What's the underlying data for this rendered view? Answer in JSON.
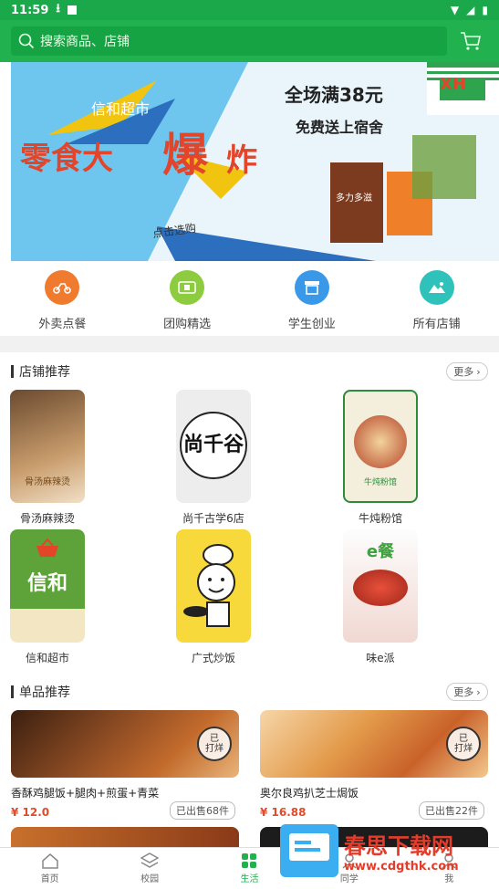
{
  "status": {
    "time": "11:59"
  },
  "header": {
    "search_placeholder": "搜索商品、店铺"
  },
  "banner": {
    "brand": "信和超市",
    "headline": "零食大",
    "headline2": "爆",
    "headline3": "炸",
    "promo_line1": "全场满38元",
    "promo_line2": "免费送上宿舍",
    "button": "点击选购",
    "logo_text": "XH",
    "chips_text": "多力多滋"
  },
  "quick": [
    {
      "label": "外卖点餐",
      "color": "#f07a2e"
    },
    {
      "label": "团购精选",
      "color": "#8ccc3e"
    },
    {
      "label": "学生创业",
      "color": "#3a98e8"
    },
    {
      "label": "所有店铺",
      "color": "#2fc2bb"
    }
  ],
  "sections": {
    "stores_title": "店铺推荐",
    "products_title": "单品推荐",
    "more": "更多"
  },
  "stores": [
    {
      "name": "骨汤麻辣烫",
      "pic_text": "骨汤麻辣烫"
    },
    {
      "name": "尚千古学6店",
      "pic_text": "尚千谷"
    },
    {
      "name": "牛炖粉馆",
      "pic_text": "牛炖粉馆"
    },
    {
      "name": "信和超市",
      "pic_text": "信和"
    },
    {
      "name": "广式炒饭",
      "pic_text": ""
    },
    {
      "name": "味e派",
      "pic_text": "e餐"
    }
  ],
  "products": [
    {
      "name": "香酥鸡腿饭+腿肉+煎蛋+青菜",
      "price": "¥ 12.0",
      "sold": "已出售68件",
      "stamp1": "已",
      "stamp2": "打烊"
    },
    {
      "name": "奥尔良鸡扒芝士焗饭",
      "price": "¥ 16.88",
      "sold": "已出售22件",
      "stamp1": "已",
      "stamp2": "打烊"
    }
  ],
  "tabs": [
    {
      "label": "首页"
    },
    {
      "label": "校园"
    },
    {
      "label": "生活"
    },
    {
      "label": "同学"
    },
    {
      "label": "我"
    }
  ],
  "watermark": {
    "title": "春思下载网",
    "url": "www.cdgthk.com"
  }
}
